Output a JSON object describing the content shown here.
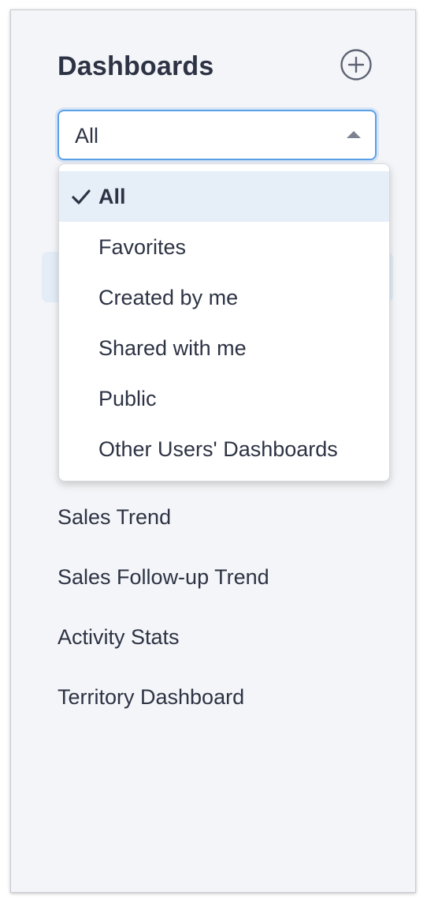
{
  "header": {
    "title": "Dashboards",
    "add_icon": "plus-circle-icon"
  },
  "filter": {
    "selected": "All",
    "options": [
      {
        "label": "All",
        "selected": true
      },
      {
        "label": "Favorites",
        "selected": false
      },
      {
        "label": "Created by me",
        "selected": false
      },
      {
        "label": "Shared with me",
        "selected": false
      },
      {
        "label": "Public",
        "selected": false
      },
      {
        "label": "Other Users' Dashboards",
        "selected": false
      }
    ]
  },
  "dashboards": [
    {
      "label": "Sales Trend"
    },
    {
      "label": "Sales Follow-up Trend"
    },
    {
      "label": "Activity Stats"
    },
    {
      "label": "Territory Dashboard"
    }
  ],
  "colors": {
    "panel_bg": "#f4f5f8",
    "focus_border": "#5aa0e8",
    "selected_row": "#e6eef8",
    "text": "#2d3344"
  }
}
